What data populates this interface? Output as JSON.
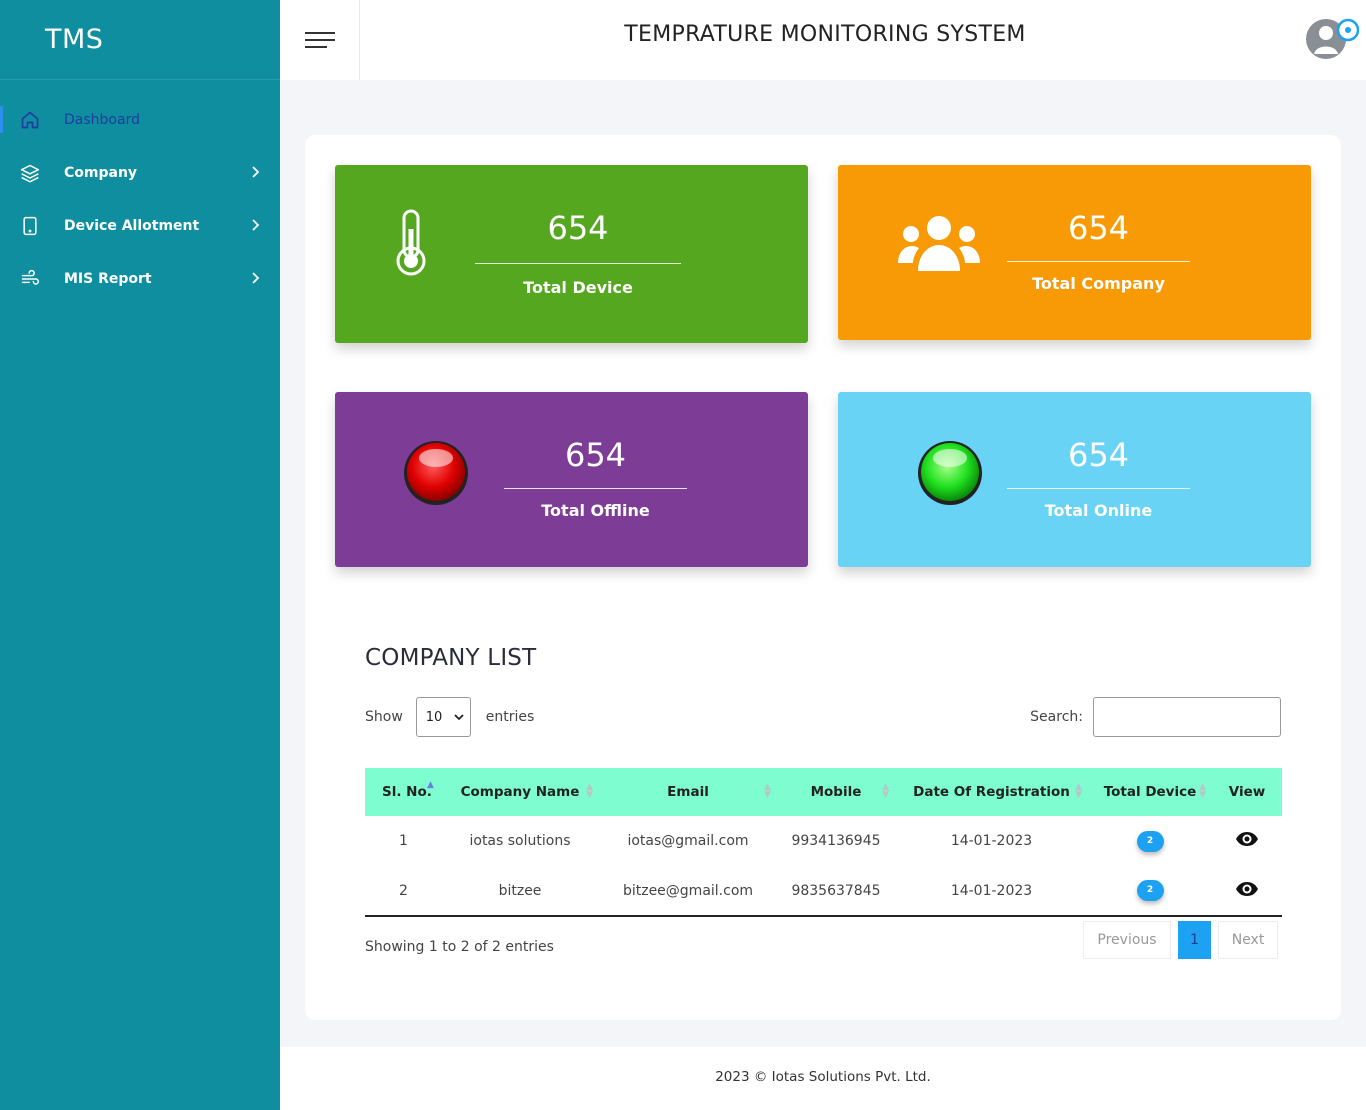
{
  "sidebar": {
    "brand": "TMS",
    "items": [
      {
        "label": "Dashboard",
        "icon": "home-icon",
        "active": true
      },
      {
        "label": "Company",
        "icon": "layers-icon"
      },
      {
        "label": "Device Allotment",
        "icon": "tablet-icon"
      },
      {
        "label": "MIS Report",
        "icon": "wind-icon"
      }
    ]
  },
  "header": {
    "title": "TEMPRATURE MONITORING SYSTEM"
  },
  "stats": [
    {
      "value": "654",
      "label": "Total Device",
      "color": "#55a71f",
      "icon": "thermometer-icon"
    },
    {
      "value": "654",
      "label": "Total Company",
      "color": "#f79a05",
      "icon": "users-icon"
    },
    {
      "value": "654",
      "label": "Total Offline",
      "color": "#7d3c95",
      "icon": "red-status-icon"
    },
    {
      "value": "654",
      "label": "Total Online",
      "color": "#69d3f5",
      "icon": "green-status-icon"
    }
  ],
  "company_list": {
    "title": "COMPANY LIST",
    "show_label": "Show",
    "page_size": "10",
    "entries_label": "entries",
    "search_label": "Search:",
    "search_value": "",
    "columns": [
      "Sl. No.",
      "Company Name",
      "Email",
      "Mobile",
      "Date Of Registration",
      "Total Device",
      "View"
    ],
    "rows": [
      {
        "sl": "1",
        "name": "iotas solutions",
        "email": "iotas@gmail.com",
        "mobile": "9934136945",
        "date": "14-01-2023",
        "devices": "2"
      },
      {
        "sl": "2",
        "name": "bitzee",
        "email": "bitzee@gmail.com",
        "mobile": "9835637845",
        "date": "14-01-2023",
        "devices": "2"
      }
    ],
    "info": "Showing 1 to 2 of 2 entries",
    "pagination": {
      "previous": "Previous",
      "current": "1",
      "next": "Next"
    }
  },
  "footer": "2023 © Iotas Solutions Pvt. Ltd.",
  "colors": {
    "sidebar": "#0e8e9f",
    "table_header": "#7dfdd0",
    "badge": "#1da1f2",
    "pager_active": "#1da1f2"
  }
}
